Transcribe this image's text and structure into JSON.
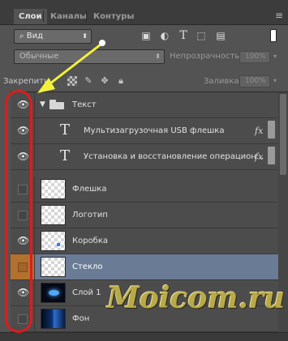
{
  "tabs": [
    "Слои",
    "Каналы",
    "Контуры"
  ],
  "filter": {
    "kind_value": "Вид"
  },
  "blend": {
    "mode": "Обычные",
    "opacity_label": "Непрозрачность:",
    "opacity_value": "100%"
  },
  "lock": {
    "label": "Закрепить:",
    "fill_label": "Заливка:",
    "fill_value": "100%"
  },
  "group": {
    "name": "Текст"
  },
  "layers": [
    {
      "name": "Мультизагрузочная USB флешка",
      "type": "text"
    },
    {
      "name": "Установка и восстановление операцион...",
      "type": "text"
    },
    {
      "name": "Флешка",
      "type": "image"
    },
    {
      "name": "Логотип",
      "type": "image"
    },
    {
      "name": "Коробка",
      "type": "image"
    },
    {
      "name": "Стекло",
      "type": "image",
      "selected": true
    },
    {
      "name": "Слой 1",
      "type": "image"
    },
    {
      "name": "Фон",
      "type": "image"
    }
  ],
  "watermark": "Moicom.ru",
  "colors": {
    "highlight_oval": "#e01b1b",
    "arrow": "#f2f23a",
    "selection": "#6a7b95",
    "selected_eye_cell": "#b4712e"
  }
}
